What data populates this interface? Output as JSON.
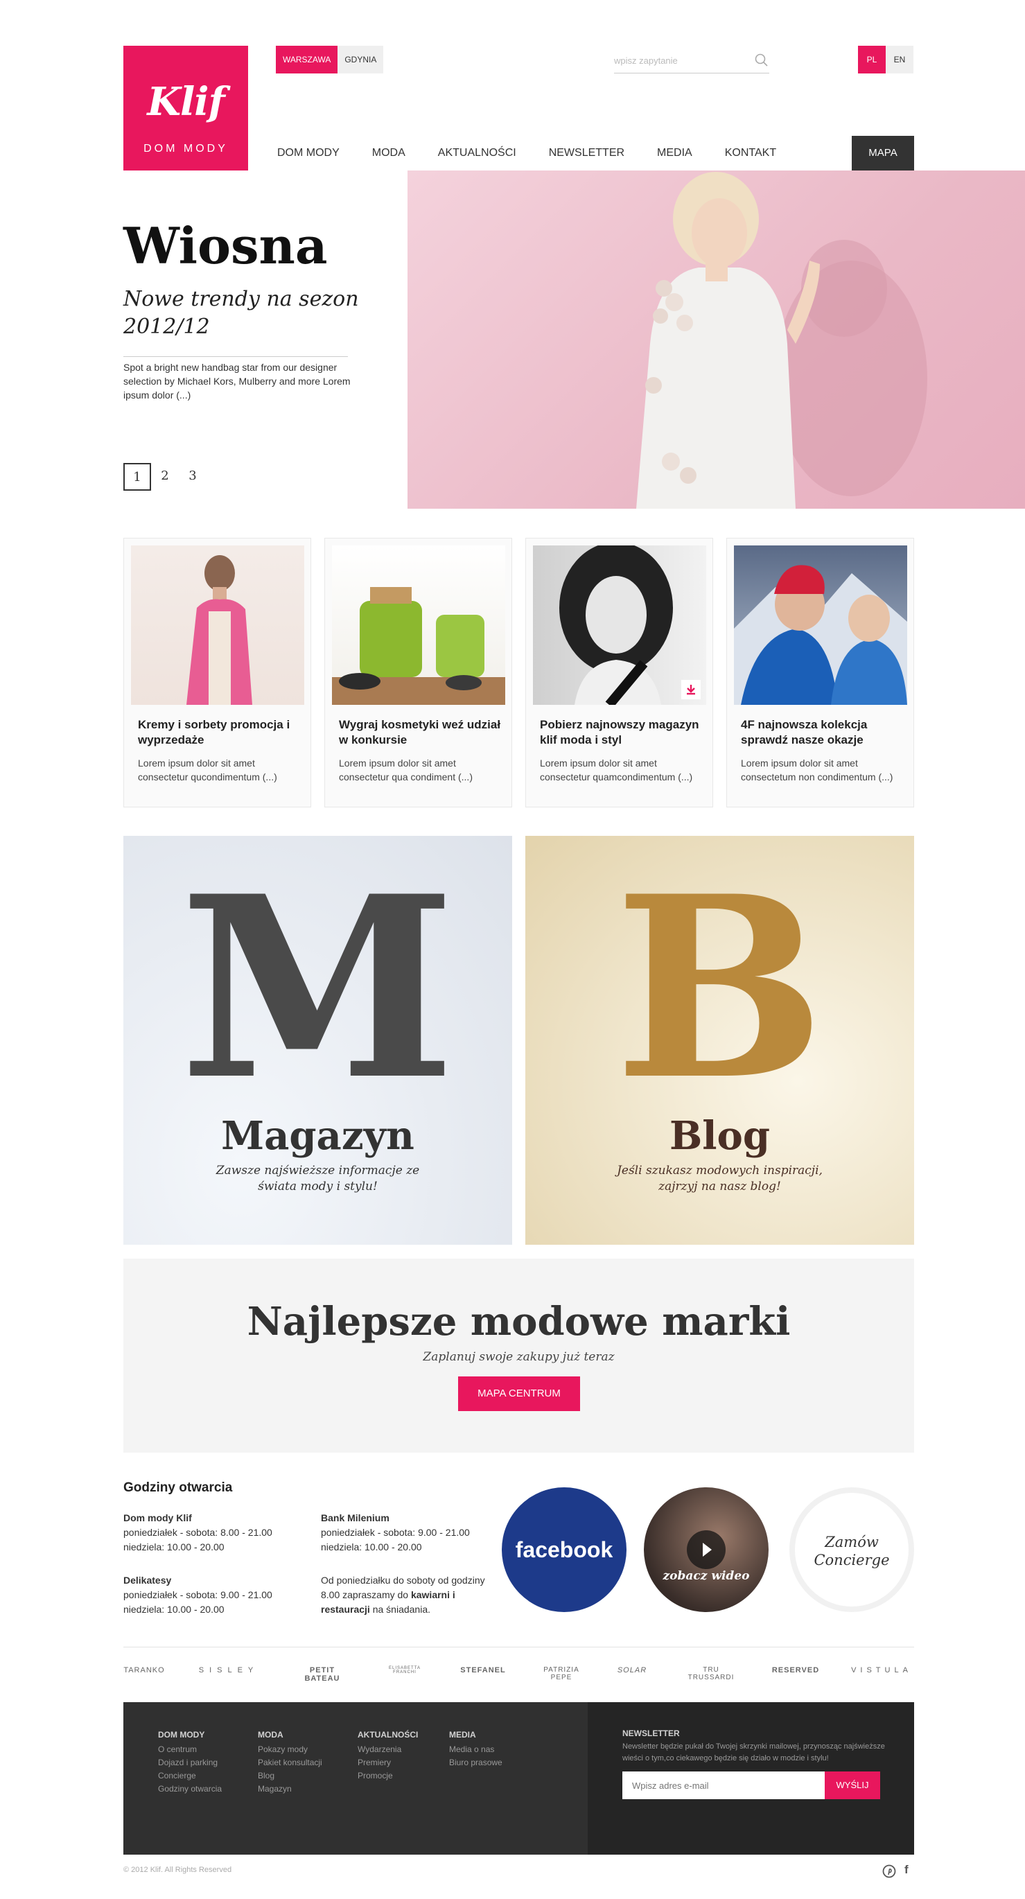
{
  "header": {
    "logo_script": "Klif",
    "logo_sub": "DOM MODY",
    "cities": [
      "WARSZAWA",
      "GDYNIA"
    ],
    "search_placeholder": "wpisz zapytanie",
    "langs": [
      "PL",
      "EN"
    ],
    "nav": [
      "DOM MODY",
      "MODA",
      "AKTUALNOŚCI",
      "NEWSLETTER",
      "MEDIA",
      "KONTAKT"
    ],
    "mapa": "MAPA"
  },
  "hero": {
    "title": "Wiosna",
    "subtitle": "Nowe trendy na sezon 2012/12",
    "text": "Spot a bright new handbag star from our designer selection by Michael Kors, Mulberry and more Lorem ipsum dolor (...)",
    "pages": [
      "1",
      "2",
      "3"
    ]
  },
  "cards": [
    {
      "title": "Kremy i sorbety promocja i wyprzedaże",
      "desc": "Lorem ipsum dolor sit amet consectetur qucondimentum (...)"
    },
    {
      "title": "Wygraj kosmetyki weź udział w konkursie",
      "desc": "Lorem ipsum dolor sit amet consectetur qua condiment (...)"
    },
    {
      "title": "Pobierz najnowszy magazyn klif moda i styl",
      "desc": "Lorem ipsum dolor sit amet consectetur quamcondimentum (...)"
    },
    {
      "title": "4F najnowsza kolekcja sprawdź nasze okazje",
      "desc": "Lorem ipsum dolor sit amet consectetum non condimentum (...)"
    }
  ],
  "tiles": {
    "magazyn": {
      "letter": "M",
      "label": "Magazyn",
      "desc": "Zawsze najświeższe informacje ze świata mody i stylu!"
    },
    "blog": {
      "letter": "B",
      "label": "Blog",
      "desc": "Jeśli szukasz modowych inspiracji, zajrzyj na nasz blog!"
    }
  },
  "brands_banner": {
    "title": "Najlepsze modowe marki",
    "subtitle": "Zaplanuj swoje zakupy już teraz",
    "button": "MAPA CENTRUM"
  },
  "hours": {
    "title": "Godziny otwarcia",
    "dom_mody": {
      "name": "Dom mody Klif",
      "line1": "poniedziałek - sobota:  8.00 - 21.00",
      "line2": "niedziela:  10.00 - 20.00"
    },
    "bank": {
      "name": "Bank Milenium",
      "line1": "poniedziałek - sobota:  9.00 - 21.00",
      "line2": "niedziela:  10.00 - 20.00"
    },
    "delikatesy": {
      "name": "Delikatesy",
      "line1": "poniedziałek - sobota:  9.00 - 21.00",
      "line2": "niedziela:  10.00 - 20.00"
    },
    "note_a": "Od poniedziałku do soboty od godziny 8.00 zapraszamy do ",
    "note_b": "kawiarni i restauracji",
    "note_c": " na śniadania."
  },
  "circles": {
    "facebook": "facebook",
    "video": "zobacz wideo",
    "concierge": "Zamów Concierge"
  },
  "brand_logos": [
    "TARANKO",
    "SISLEY",
    "PETIT BATEAU",
    "ELISABETTA FRANCHI",
    "STEFANEL",
    "PATRIZIA PEPE",
    "SOLAR",
    "TRU TRUSSARDI",
    "RESERVED",
    "VISTULA"
  ],
  "footer": {
    "cols": [
      {
        "head": "DOM MODY",
        "items": [
          "O centrum",
          "Dojazd i parking",
          "Concierge",
          "Godziny otwarcia"
        ]
      },
      {
        "head": "MODA",
        "items": [
          "Pokazy mody",
          "Pakiet konsultacji",
          "Blog",
          "Magazyn"
        ]
      },
      {
        "head": "AKTUALNOŚCI",
        "items": [
          "Wydarzenia",
          "Premiery",
          "Promocje"
        ]
      },
      {
        "head": "MEDIA",
        "items": [
          "Media o nas",
          "Biuro prasowe"
        ]
      }
    ],
    "newsletter_title": "NEWSLETTER",
    "newsletter_text": "Newsletter będzie pukał do Twojej skrzynki mailowej, przynosząc najświeższe wieści o tym,co ciekawego będzie się działo w modzie i stylu!",
    "email_placeholder": "Wpisz adres e-mail",
    "send": "WYŚLIJ"
  },
  "copyright": "© 2012 Klif. All Rights Reserved",
  "colors": {
    "accent": "#e8175d",
    "dark": "#303030",
    "facebook": "#1d3a8a"
  }
}
